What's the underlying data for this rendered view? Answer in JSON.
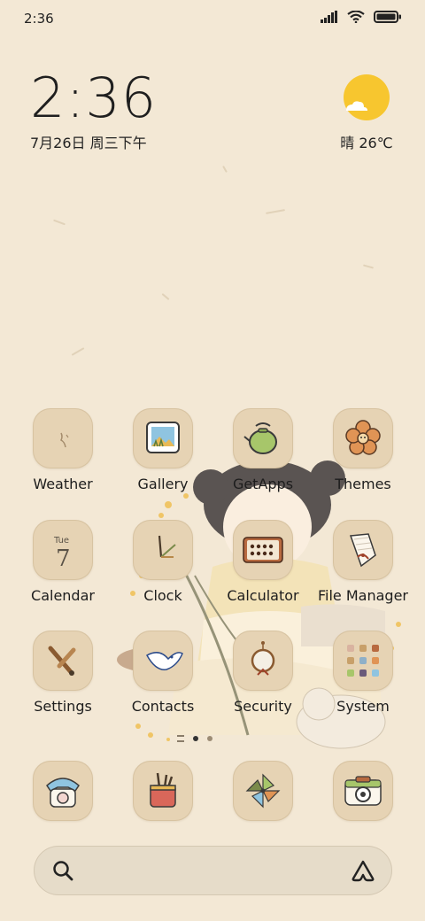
{
  "status_bar": {
    "time": "2:36"
  },
  "clock_widget": {
    "time": "2:36",
    "date": "7月26日 周三下午"
  },
  "weather_widget": {
    "text": "晴 26℃",
    "icon": "sun-cloud-icon"
  },
  "apps": [
    {
      "id": "weather",
      "label": "Weather",
      "icon": "weather-icon"
    },
    {
      "id": "gallery",
      "label": "Gallery",
      "icon": "gallery-icon"
    },
    {
      "id": "getapps",
      "label": "GetApps",
      "icon": "teapot-icon"
    },
    {
      "id": "themes",
      "label": "Themes",
      "icon": "flower-icon"
    },
    {
      "id": "calendar",
      "label": "Calendar",
      "icon": "calendar-icon",
      "badge_day": "Tue",
      "badge_date": "7"
    },
    {
      "id": "clock",
      "label": "Clock",
      "icon": "clock-icon"
    },
    {
      "id": "calculator",
      "label": "Calculator",
      "icon": "calculator-icon"
    },
    {
      "id": "filemanager",
      "label": "File Manager",
      "icon": "scroll-icon"
    },
    {
      "id": "settings",
      "label": "Settings",
      "icon": "tools-icon"
    },
    {
      "id": "contacts",
      "label": "Contacts",
      "icon": "bird-icon"
    },
    {
      "id": "security",
      "label": "Security",
      "icon": "mirror-icon"
    },
    {
      "id": "system",
      "label": "System",
      "icon": "folder-icon"
    }
  ],
  "dock": [
    {
      "id": "phone",
      "icon": "phone-icon"
    },
    {
      "id": "notes",
      "icon": "brush-pot-icon"
    },
    {
      "id": "browser",
      "icon": "pinwheel-icon"
    },
    {
      "id": "camera",
      "icon": "camera-icon"
    }
  ],
  "pager": {
    "pages": 2,
    "current": 1
  },
  "search": {
    "left_icon": "search-icon",
    "right_icon": "assistant-icon"
  },
  "colors": {
    "background": "#f3e8d5",
    "tile": "#e6d3b4",
    "sun": "#f7c62f"
  }
}
